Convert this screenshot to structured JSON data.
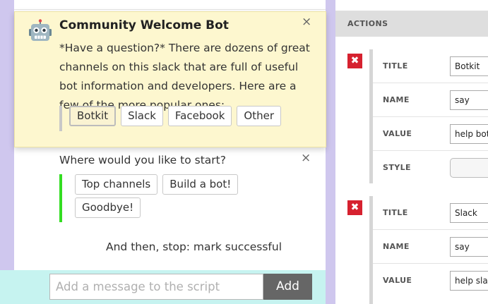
{
  "chat": {
    "card": {
      "bot_name": "Community Welcome Bot",
      "close_glyph": "×",
      "text": "*Have a question?* There are dozens of great channels on this slack that are full of useful bot information and developers. Here are a few of the more popular ones:",
      "buttons": [
        "Botkit",
        "Slack",
        "Facebook",
        "Other"
      ]
    },
    "question": {
      "text": "Where would you like to start?",
      "close_glyph": "×",
      "buttons": [
        "Top channels",
        "Build a bot!",
        "Goodbye!"
      ]
    },
    "end_text": "And then, stop: mark successful",
    "composer": {
      "placeholder": "Add a message to the script",
      "add_label": "Add"
    }
  },
  "panel": {
    "header": "ACTIONS",
    "delete_glyph": "✖",
    "actions": [
      {
        "fields": [
          {
            "label": "TITLE",
            "value": "Botkit"
          },
          {
            "label": "NAME",
            "value": "say"
          },
          {
            "label": "VALUE",
            "value": "help bot"
          },
          {
            "label": "STYLE",
            "value": ""
          }
        ]
      },
      {
        "fields": [
          {
            "label": "TITLE",
            "value": "Slack"
          },
          {
            "label": "NAME",
            "value": "say"
          },
          {
            "label": "VALUE",
            "value": "help slac"
          }
        ]
      }
    ]
  },
  "colors": {
    "frame": "#cfc7ee",
    "card_bg": "#fdf7cf",
    "attachment_accent": "#33dd22",
    "composer_bg": "#c6f3f0",
    "delete_red": "#d6212f"
  },
  "icons": {
    "bot_avatar": "robot-icon",
    "close": "close-icon",
    "delete": "delete-icon"
  }
}
